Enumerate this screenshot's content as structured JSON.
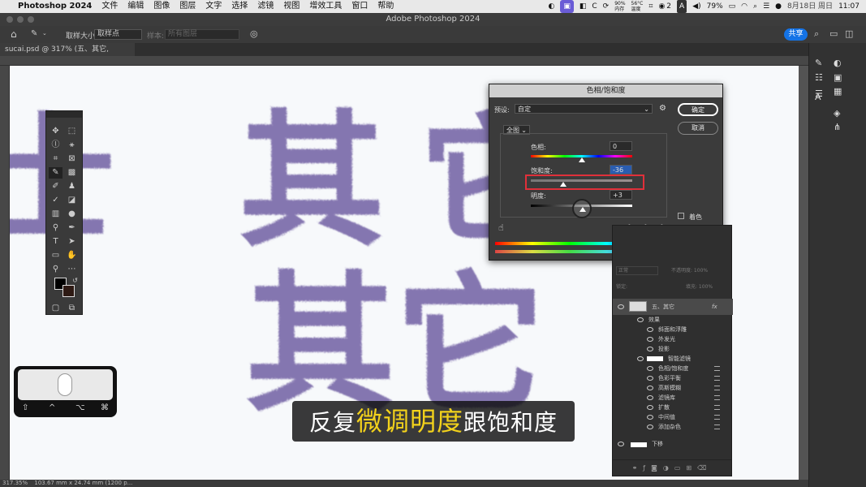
{
  "menubar": {
    "app": "Photoshop 2024",
    "items": [
      "文件",
      "编辑",
      "图像",
      "图层",
      "文字",
      "选择",
      "滤镜",
      "视图",
      "增效工具",
      "窗口",
      "帮助"
    ],
    "status": {
      "mem": "90%\n内存",
      "temp": "56°C\n温度",
      "wechat_count": "2",
      "input_method": "A",
      "battery": "79%",
      "date": "8月18日 周日",
      "time": "11:07"
    }
  },
  "window_title": "Adobe Photoshop 2024",
  "options_bar": {
    "sample_size_label": "取样大小:",
    "sample_size_value": "取样点",
    "sample_label": "样本:",
    "sample_value": "所有图层",
    "share": "共享"
  },
  "doc_tab": {
    "label": "sucai.psd @ 317% (五、其它, RGB/8#) *",
    "close": "×"
  },
  "statusbar": {
    "zoom": "317.35%",
    "info": "103.67 mm x 24.74 mm (1200 p..."
  },
  "hue_sat_dialog": {
    "title": "色相/饱和度",
    "preset_label": "预设:",
    "preset_value": "自定",
    "ok": "确定",
    "cancel": "取消",
    "channel": "全图",
    "hue_label": "色相:",
    "hue_value": "0",
    "saturation_label": "饱和度:",
    "saturation_value": "-36",
    "lightness_label": "明度:",
    "lightness_value": "+3",
    "colorize_label": "着色",
    "colorize_checked": false,
    "preview_label": "预览",
    "preview_checked": true,
    "slider_levels": {
      "hue": 0,
      "saturation": -36,
      "lightness": 3
    }
  },
  "layers_panel": {
    "blend_mode": "正常",
    "opacity_label": "不透明度: 100%",
    "lock_label": "锁定:",
    "fill_label": "填充: 100%",
    "layers": [
      {
        "name": "五、其它",
        "kind": "layer"
      },
      {
        "name": "效果",
        "kind": "group"
      },
      {
        "name": "斜面和浮雕",
        "kind": "effect"
      },
      {
        "name": "外发光",
        "kind": "effect"
      },
      {
        "name": "投影",
        "kind": "effect"
      },
      {
        "name": "智能滤镜",
        "kind": "smartfilter"
      },
      {
        "name": "色相/饱和度",
        "kind": "filter"
      },
      {
        "name": "色彩平衡",
        "kind": "filter"
      },
      {
        "name": "高斯模糊",
        "kind": "filter"
      },
      {
        "name": "滤镜库",
        "kind": "filter"
      },
      {
        "name": "扩散",
        "kind": "filter"
      },
      {
        "name": "中间值",
        "kind": "filter"
      },
      {
        "name": "添加杂色",
        "kind": "filter"
      },
      {
        "name": "下移",
        "kind": "layer"
      }
    ]
  },
  "canvas_text": {
    "line1_left": "士",
    "line1_mid": "其",
    "line1_right": "它",
    "line2": "其它"
  },
  "subtitle": {
    "before": "反复",
    "highlight": "微调明度",
    "after": "跟饱和度"
  },
  "key_overlay": {
    "keys": [
      "⇧",
      "^",
      "⌥",
      "⌘"
    ]
  },
  "colors": {
    "highlight_box": "#e0303a",
    "subtitle_highlight": "#f3d21b",
    "share_button": "#1473e6",
    "canvas_ink": "#7868a8"
  },
  "icons": [
    "apple-icon",
    "home-icon",
    "eyedropper-icon",
    "search-icon",
    "wifi-icon",
    "battery-icon",
    "move-icon",
    "marquee-icon",
    "lasso-icon",
    "magic-wand-icon",
    "crop-icon",
    "frame-icon",
    "brush-icon",
    "stamp-icon",
    "eraser-icon",
    "gradient-icon",
    "pen-icon",
    "type-icon",
    "hand-icon",
    "zoom-icon",
    "eye-icon",
    "fx-icon",
    "gear-icon",
    "mouse-icon"
  ]
}
